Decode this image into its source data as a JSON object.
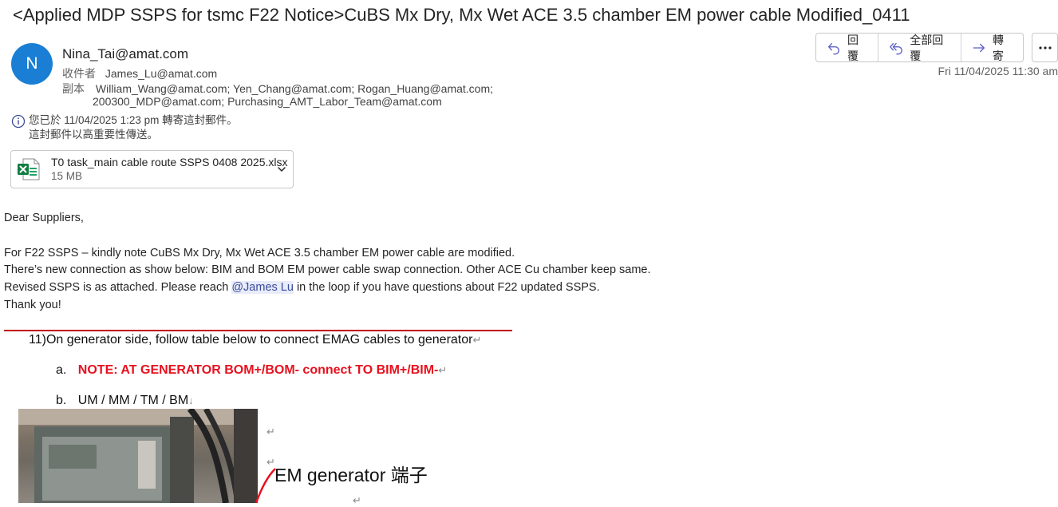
{
  "subject": "<Applied MDP SSPS for tsmc F22 Notice>CuBS Mx Dry, Mx Wet ACE 3.5 chamber EM power cable Modified_0411",
  "sender": {
    "initial": "N",
    "avatar_color": "#1a7fd4",
    "email": "Nina_Tai@amat.com"
  },
  "recipients": {
    "to_label": "收件者",
    "to": "James_Lu@amat.com",
    "cc_label": "副本",
    "cc_line1": "William_Wang@amat.com; Yen_Chang@amat.com; Rogan_Huang@amat.com;",
    "cc_line2": "200300_MDP@amat.com; Purchasing_AMT_Labor_Team@amat.com"
  },
  "actions": {
    "reply": "回覆",
    "reply_all": "全部回覆",
    "forward": "轉寄",
    "more_icon": "ellipsis-icon"
  },
  "date": "Fri 11/04/2025 11:30 am",
  "info": {
    "line1": "您已於 11/04/2025 1:23 pm 轉寄這封郵件。",
    "line2": "這封郵件以高重要性傳送。"
  },
  "attachment": {
    "name": "T0 task_main cable route SSPS 0408 2025.xlsx",
    "size": "15 MB",
    "icon": "excel-icon"
  },
  "body": {
    "greeting": "Dear Suppliers,",
    "line1": "For F22 SSPS – kindly note CuBS Mx Dry, Mx Wet ACE 3.5 chamber EM power cable are modified.",
    "line2": "There’s new connection as show below: BIM and BOM EM power cable swap connection. Other ACE Cu chamber keep same.",
    "line3_before": "Revised SSPS is as attached. Please reach ",
    "mention": "@James Lu",
    "line3_after": " in the loop if you have questions about F22 updated SSPS.",
    "thanks": "Thank you!"
  },
  "embedded_doc": {
    "step": "11)On generator side, follow table below to connect EMAG cables to generator",
    "item_a_marker": "a.",
    "item_a": "NOTE: AT GENERATOR BOM+/BOM- connect TO BIM+/BIM-",
    "item_b_marker": "b.",
    "item_b": "UM / MM / TM / BM",
    "em_label": "EM generator 端子"
  }
}
